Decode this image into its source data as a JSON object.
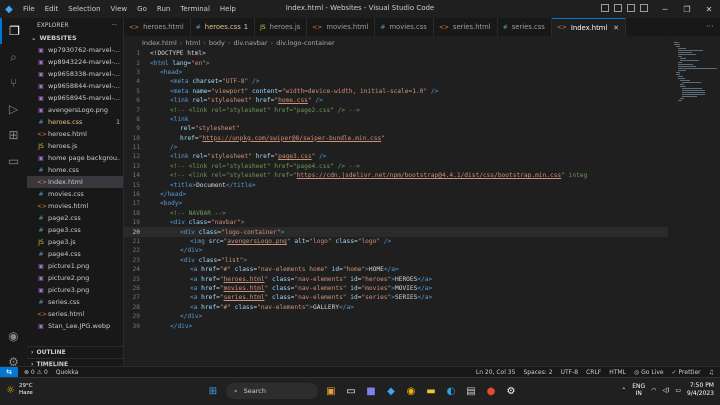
{
  "titlebar": {
    "menu": [
      "File",
      "Edit",
      "Selection",
      "View",
      "Go",
      "Run",
      "Terminal",
      "Help"
    ],
    "title": "Index.html - Websites - Visual Studio Code"
  },
  "sidebar": {
    "header": "EXPLORER",
    "root": "WEBSITES",
    "items": [
      {
        "name": "wp7930762-marvel-...",
        "type": "image",
        "badge": ""
      },
      {
        "name": "wp8943224-marvel-...",
        "type": "image",
        "badge": ""
      },
      {
        "name": "wp9658338-marvel-...",
        "type": "image",
        "badge": ""
      },
      {
        "name": "wp9658844-marvel-...",
        "type": "image",
        "badge": ""
      },
      {
        "name": "wp9658945-marvel-...",
        "type": "image",
        "badge": ""
      },
      {
        "name": "avengersLogo.png",
        "type": "image",
        "badge": ""
      },
      {
        "name": "heroes.css",
        "type": "css",
        "badge": "1"
      },
      {
        "name": "heroes.html",
        "type": "html",
        "badge": ""
      },
      {
        "name": "heroes.js",
        "type": "js",
        "badge": ""
      },
      {
        "name": "home page backgrou...",
        "type": "image",
        "badge": ""
      },
      {
        "name": "home.css",
        "type": "css",
        "badge": ""
      },
      {
        "name": "Index.html",
        "type": "html",
        "badge": ""
      },
      {
        "name": "movies.css",
        "type": "css",
        "badge": ""
      },
      {
        "name": "movies.html",
        "type": "html",
        "badge": ""
      },
      {
        "name": "page2.css",
        "type": "css",
        "badge": ""
      },
      {
        "name": "page3.css",
        "type": "css",
        "badge": ""
      },
      {
        "name": "page3.js",
        "type": "js",
        "badge": ""
      },
      {
        "name": "page4.css",
        "type": "css",
        "badge": ""
      },
      {
        "name": "picture1.png",
        "type": "image",
        "badge": ""
      },
      {
        "name": "picture2.png",
        "type": "image",
        "badge": ""
      },
      {
        "name": "picture3.png",
        "type": "image",
        "badge": ""
      },
      {
        "name": "series.css",
        "type": "css",
        "badge": ""
      },
      {
        "name": "series.html",
        "type": "html",
        "badge": ""
      },
      {
        "name": "Stan_Lee.JPG.webp",
        "type": "image",
        "badge": ""
      }
    ],
    "outline": "OUTLINE",
    "timeline": "TIMELINE"
  },
  "tabs": [
    {
      "label": "heroes.html",
      "type": "html",
      "badge": ""
    },
    {
      "label": "heroes.css",
      "type": "css",
      "badge": "1"
    },
    {
      "label": "heroes.js",
      "type": "js",
      "badge": ""
    },
    {
      "label": "movies.html",
      "type": "html",
      "badge": ""
    },
    {
      "label": "movies.css",
      "type": "css",
      "badge": ""
    },
    {
      "label": "series.html",
      "type": "html",
      "badge": ""
    },
    {
      "label": "series.css",
      "type": "css",
      "badge": ""
    },
    {
      "label": "Index.html",
      "type": "html",
      "badge": ""
    }
  ],
  "breadcrumb": [
    "Index.html",
    "html",
    "body",
    "div.navbar",
    "div.logo-container"
  ],
  "editor": {
    "current_line": 20,
    "lines": [
      {
        "n": 1,
        "i": 1,
        "t": [
          [
            "pl",
            "<!DOCTYPE html>"
          ]
        ]
      },
      {
        "n": 2,
        "i": 1,
        "t": [
          [
            "tg",
            "<html"
          ],
          [
            "at",
            " lang"
          ],
          [
            "pl",
            "="
          ],
          [
            "st",
            "\"en\""
          ],
          [
            "tg",
            ">"
          ]
        ]
      },
      {
        "n": 3,
        "i": 2,
        "t": [
          [
            "tg",
            "<head>"
          ]
        ]
      },
      {
        "n": 4,
        "i": 3,
        "t": [
          [
            "tg",
            "<meta"
          ],
          [
            "at",
            " charset"
          ],
          [
            "pl",
            "="
          ],
          [
            "st",
            "\"UTF-8\""
          ],
          [
            "tg",
            " />"
          ]
        ]
      },
      {
        "n": 5,
        "i": 3,
        "t": [
          [
            "tg",
            "<meta"
          ],
          [
            "at",
            " name"
          ],
          [
            "pl",
            "="
          ],
          [
            "st",
            "\"viewport\""
          ],
          [
            "at",
            " content"
          ],
          [
            "pl",
            "="
          ],
          [
            "st",
            "\"width=device-width, initial-scale=1.0\""
          ],
          [
            "tg",
            " />"
          ]
        ]
      },
      {
        "n": 6,
        "i": 3,
        "t": [
          [
            "tg",
            "<link"
          ],
          [
            "at",
            " rel"
          ],
          [
            "pl",
            "="
          ],
          [
            "st",
            "\"stylesheet\""
          ],
          [
            "at",
            " href"
          ],
          [
            "pl",
            "="
          ],
          [
            "st",
            "\""
          ],
          [
            "stu",
            "home.css"
          ],
          [
            "st",
            "\""
          ],
          [
            "tg",
            " />"
          ]
        ]
      },
      {
        "n": 7,
        "i": 3,
        "t": [
          [
            "cm",
            "<!-- <link rel=\"stylesheet\" href=\"page2.css\" /> -->"
          ]
        ]
      },
      {
        "n": 8,
        "i": 3,
        "t": [
          [
            "tg",
            "<link"
          ]
        ]
      },
      {
        "n": 9,
        "i": 4,
        "t": [
          [
            "at",
            "rel"
          ],
          [
            "pl",
            "="
          ],
          [
            "st",
            "\"stylesheet\""
          ]
        ]
      },
      {
        "n": 10,
        "i": 4,
        "t": [
          [
            "at",
            "href"
          ],
          [
            "pl",
            "="
          ],
          [
            "st",
            "\""
          ],
          [
            "stu",
            "https://unpkg.com/swiper@8/swiper-bundle.min.css"
          ],
          [
            "st",
            "\""
          ]
        ]
      },
      {
        "n": 11,
        "i": 3,
        "t": [
          [
            "tg",
            "/>"
          ]
        ]
      },
      {
        "n": 12,
        "i": 3,
        "t": [
          [
            "tg",
            "<link"
          ],
          [
            "at",
            " rel"
          ],
          [
            "pl",
            "="
          ],
          [
            "st",
            "\"stylesheet\""
          ],
          [
            "at",
            " href"
          ],
          [
            "pl",
            "="
          ],
          [
            "st",
            "\""
          ],
          [
            "stu",
            "page3.css"
          ],
          [
            "st",
            "\""
          ],
          [
            "tg",
            " />"
          ]
        ]
      },
      {
        "n": 13,
        "i": 3,
        "t": [
          [
            "cm",
            "<!-- <link rel=\"stylesheet\" href=\"page4.css\" /> -->"
          ]
        ]
      },
      {
        "n": 14,
        "i": 3,
        "t": [
          [
            "cm",
            "<!-- <link rel=\"stylesheet\" href=\""
          ],
          [
            "stu",
            "https://cdn.jsdelivr.net/npm/bootstrap@4.4.1/dist/css/bootstrap.min.css"
          ],
          [
            "cm",
            "\" integ"
          ]
        ]
      },
      {
        "n": 15,
        "i": 3,
        "t": [
          [
            "tg",
            "<title>"
          ],
          [
            "pl",
            "Document"
          ],
          [
            "tg",
            "</title>"
          ]
        ]
      },
      {
        "n": 16,
        "i": 2,
        "t": [
          [
            "tg",
            "</head>"
          ]
        ]
      },
      {
        "n": 17,
        "i": 2,
        "t": [
          [
            "tg",
            "<body>"
          ]
        ]
      },
      {
        "n": 18,
        "i": 3,
        "t": [
          [
            "cm",
            "<!-- NAVBAR -->"
          ]
        ]
      },
      {
        "n": 19,
        "i": 3,
        "t": [
          [
            "tg",
            "<div"
          ],
          [
            "at",
            " class"
          ],
          [
            "pl",
            "="
          ],
          [
            "st",
            "\"navbar\""
          ],
          [
            "tg",
            ">"
          ]
        ]
      },
      {
        "n": 20,
        "i": 4,
        "t": [
          [
            "tg",
            "<div"
          ],
          [
            "at",
            " class"
          ],
          [
            "pl",
            "="
          ],
          [
            "st",
            "\"logo-container\""
          ],
          [
            "tg",
            ">"
          ]
        ]
      },
      {
        "n": 21,
        "i": 5,
        "t": [
          [
            "tg",
            "<img"
          ],
          [
            "at",
            " src"
          ],
          [
            "pl",
            "="
          ],
          [
            "st",
            "\""
          ],
          [
            "stu",
            "avengersLogo.png"
          ],
          [
            "st",
            "\""
          ],
          [
            "at",
            " alt"
          ],
          [
            "pl",
            "="
          ],
          [
            "st",
            "\"logo\""
          ],
          [
            "at",
            " class"
          ],
          [
            "pl",
            "="
          ],
          [
            "st",
            "\"logo\""
          ],
          [
            "tg",
            " />"
          ]
        ]
      },
      {
        "n": 22,
        "i": 4,
        "t": [
          [
            "tg",
            "</div>"
          ]
        ]
      },
      {
        "n": 23,
        "i": 4,
        "t": [
          [
            "tg",
            "<div"
          ],
          [
            "at",
            " class"
          ],
          [
            "pl",
            "="
          ],
          [
            "st",
            "\"list\""
          ],
          [
            "tg",
            ">"
          ]
        ]
      },
      {
        "n": 24,
        "i": 5,
        "t": [
          [
            "tg",
            "<a"
          ],
          [
            "at",
            " href"
          ],
          [
            "pl",
            "="
          ],
          [
            "st",
            "\"#\""
          ],
          [
            "at",
            " class"
          ],
          [
            "pl",
            "="
          ],
          [
            "st",
            "\"nav-elements home\""
          ],
          [
            "at",
            " id"
          ],
          [
            "pl",
            "="
          ],
          [
            "st",
            "\"home\""
          ],
          [
            "tg",
            ">"
          ],
          [
            "pl",
            "HOME"
          ],
          [
            "tg",
            "</a>"
          ]
        ]
      },
      {
        "n": 25,
        "i": 5,
        "t": [
          [
            "tg",
            "<a"
          ],
          [
            "at",
            " href"
          ],
          [
            "pl",
            "="
          ],
          [
            "st",
            "\""
          ],
          [
            "stu",
            "heroes.html"
          ],
          [
            "st",
            "\""
          ],
          [
            "at",
            " class"
          ],
          [
            "pl",
            "="
          ],
          [
            "st",
            "\"nav-elements\""
          ],
          [
            "at",
            " id"
          ],
          [
            "pl",
            "="
          ],
          [
            "st",
            "\"heroes\""
          ],
          [
            "tg",
            ">"
          ],
          [
            "pl",
            "HEROES"
          ],
          [
            "tg",
            "</a>"
          ]
        ]
      },
      {
        "n": 26,
        "i": 5,
        "t": [
          [
            "tg",
            "<a"
          ],
          [
            "at",
            " href"
          ],
          [
            "pl",
            "="
          ],
          [
            "st",
            "\""
          ],
          [
            "stu",
            "movies.html"
          ],
          [
            "st",
            "\""
          ],
          [
            "at",
            " class"
          ],
          [
            "pl",
            "="
          ],
          [
            "st",
            "\"nav-elements\""
          ],
          [
            "at",
            " id"
          ],
          [
            "pl",
            "="
          ],
          [
            "st",
            "\"movies\""
          ],
          [
            "tg",
            ">"
          ],
          [
            "pl",
            "MOVIES"
          ],
          [
            "tg",
            "</a>"
          ]
        ]
      },
      {
        "n": 27,
        "i": 5,
        "t": [
          [
            "tg",
            "<a"
          ],
          [
            "at",
            " href"
          ],
          [
            "pl",
            "="
          ],
          [
            "st",
            "\""
          ],
          [
            "stu",
            "series.html"
          ],
          [
            "st",
            "\""
          ],
          [
            "at",
            " class"
          ],
          [
            "pl",
            "="
          ],
          [
            "st",
            "\"nav-elements\""
          ],
          [
            "at",
            " id"
          ],
          [
            "pl",
            "="
          ],
          [
            "st",
            "\"series\""
          ],
          [
            "tg",
            ">"
          ],
          [
            "pl",
            "SERIES"
          ],
          [
            "tg",
            "</a>"
          ]
        ]
      },
      {
        "n": 28,
        "i": 5,
        "t": [
          [
            "tg",
            "<a"
          ],
          [
            "at",
            " href"
          ],
          [
            "pl",
            "="
          ],
          [
            "st",
            "\"#\""
          ],
          [
            "at",
            " class"
          ],
          [
            "pl",
            "="
          ],
          [
            "st",
            "\"nav-elements\""
          ],
          [
            "tg",
            ">"
          ],
          [
            "pl",
            "GALLERY"
          ],
          [
            "tg",
            "</a>"
          ]
        ]
      },
      {
        "n": 29,
        "i": 4,
        "t": [
          [
            "tg",
            "</div>"
          ]
        ]
      },
      {
        "n": 30,
        "i": 3,
        "t": [
          [
            "tg",
            "</div>"
          ]
        ]
      }
    ]
  },
  "statusbar": {
    "left": [
      "⊗ 0 ⚠ 0",
      "Quokka"
    ],
    "right": [
      "Ln 20, Col 35",
      "Spaces: 2",
      "UTF-8",
      "CRLF",
      "HTML",
      "Go Live",
      "Prettier"
    ]
  },
  "taskbar": {
    "weather_temp": "29°C",
    "weather_desc": "Haze",
    "search_label": "Search",
    "lang_line1": "ENG",
    "lang_line2": "IN",
    "time": "7:50 PM",
    "date": "9/4/2023"
  },
  "colors": {
    "accent": "#0078d4",
    "html_icon": "#e37933",
    "css_icon": "#519aba",
    "js_icon": "#cbcb41",
    "image_icon": "#a074c4",
    "modified": "#e2c08d"
  }
}
